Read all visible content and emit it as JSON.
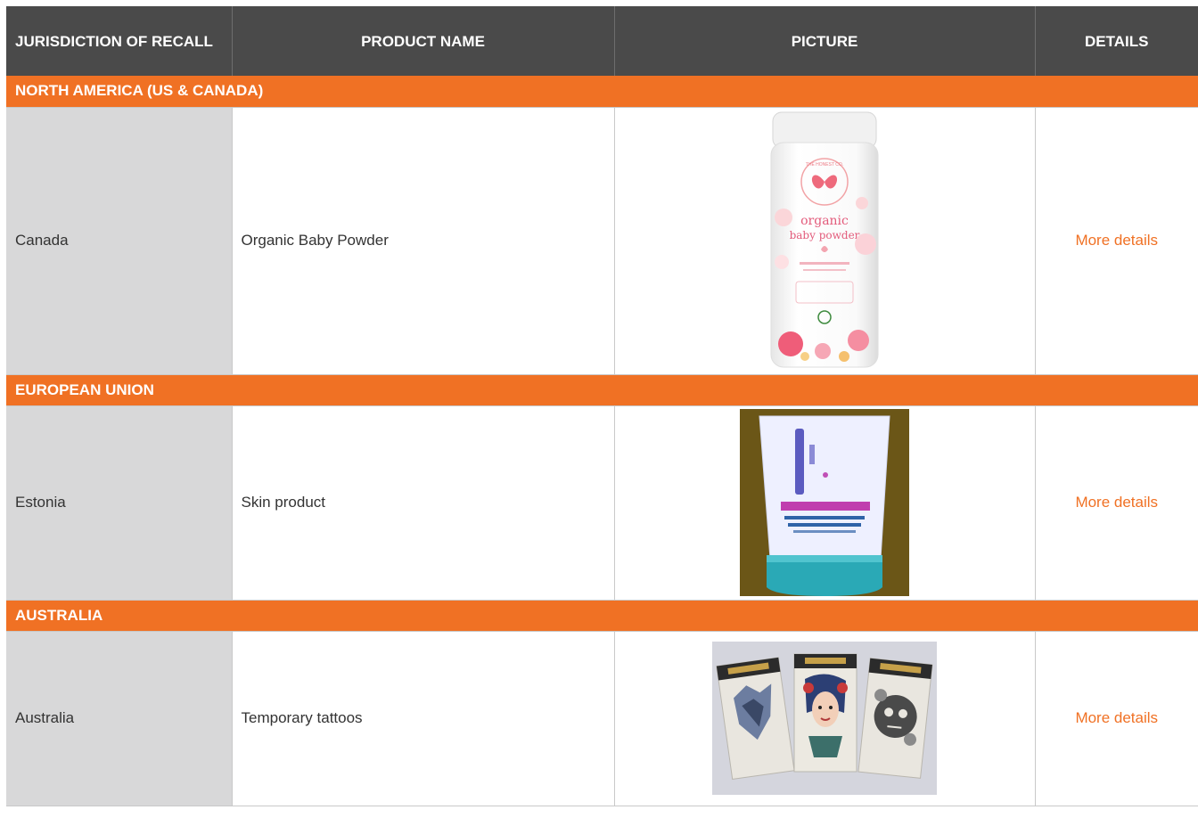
{
  "table": {
    "headers": {
      "jurisdiction": "JURISDICTION OF RECALL",
      "product": "PRODUCT NAME",
      "picture": "PICTURE",
      "details": "DETAILS"
    },
    "sections": [
      {
        "title": "NORTH AMERICA (US & CANADA)",
        "rows": [
          {
            "jurisdiction": "Canada",
            "product": "Organic Baby Powder",
            "details_link": "More details",
            "picture_icon": "baby-powder-bottle-image",
            "picture_text": {
              "brand": "THE HONEST CO.",
              "line1": "organic",
              "line2": "baby powder"
            }
          }
        ]
      },
      {
        "title": "EUROPEAN UNION",
        "rows": [
          {
            "jurisdiction": "Estonia",
            "product": "Skin product",
            "details_link": "More details",
            "picture_icon": "skin-cream-tube-image"
          }
        ]
      },
      {
        "title": "AUSTRALIA",
        "rows": [
          {
            "jurisdiction": "Australia",
            "product": "Temporary tattoos",
            "details_link": "More details",
            "picture_icon": "temporary-tattoo-packs-image"
          }
        ]
      }
    ]
  },
  "colors": {
    "header_bg": "#4a4a4a",
    "section_bg": "#f07124",
    "jurisdiction_bg": "#d8d8d9",
    "link": "#f07124"
  }
}
